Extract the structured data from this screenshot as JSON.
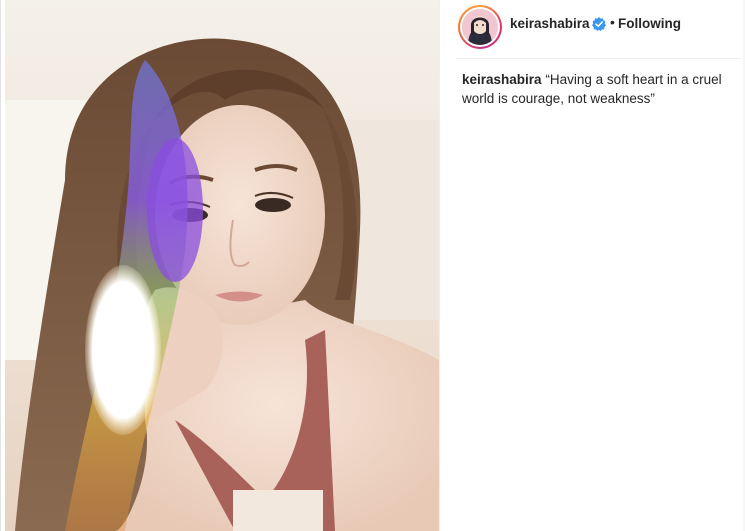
{
  "post": {
    "username": "keirashabira",
    "separator": "•",
    "follow_status": "Following",
    "verified_icon": "verified-badge-icon",
    "caption": {
      "username": "keirashabira",
      "text": "“Having a soft heart in a cruel world is courage, not weakness”"
    }
  },
  "colors": {
    "verified_blue": "#3897f0",
    "text": "#262626",
    "divider": "#efefef"
  }
}
